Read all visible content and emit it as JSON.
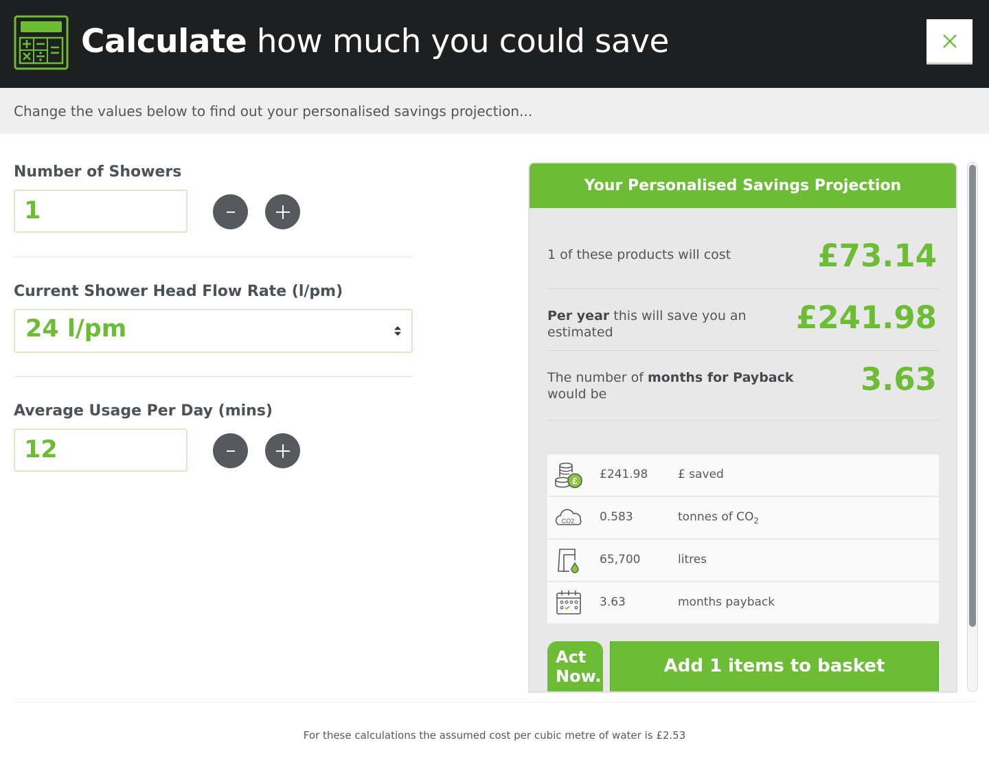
{
  "header": {
    "title_strong": "Calculate",
    "title_rest": "how much you could save",
    "close_icon": "close-icon",
    "icon": "calculator-icon"
  },
  "subheader": {
    "text": "Change the values below to find out your personalised savings projection..."
  },
  "form": {
    "showers": {
      "label": "Number of Showers",
      "value": "1"
    },
    "flow_rate": {
      "label": "Current Shower Head Flow Rate (l/pm)",
      "selected": "24 l/pm"
    },
    "usage": {
      "label": "Average Usage Per Day (mins)",
      "value": "12"
    },
    "minus_symbol": "-",
    "plus_symbol": "+"
  },
  "projection": {
    "title": "Your Personalised Savings Projection",
    "cost": {
      "label": "1 of these products will cost",
      "value": "£73.14"
    },
    "per_year": {
      "label_bold": "Per year",
      "label_rest": " this will save you an estimated",
      "value": "£241.98"
    },
    "payback": {
      "label_a": "The number of ",
      "label_bold": "months for Payback",
      "label_b": " would be",
      "value": "3.63"
    },
    "summary": [
      {
        "icon": "coins-icon",
        "value": "£241.98",
        "label": "£ saved"
      },
      {
        "icon": "co2-cloud-icon",
        "value": "0.583",
        "label": "tonnes of CO",
        "label_sub": "2"
      },
      {
        "icon": "tap-icon",
        "value": "65,700",
        "label": "litres"
      },
      {
        "icon": "calendar-icon",
        "value": "3.63",
        "label": "months payback"
      }
    ],
    "act_now": {
      "line1": "Act",
      "line2": "Now."
    },
    "basket_button": "Add 1 items to basket"
  },
  "footnote": "For these calculations the assumed cost per cubic metre of water is £2.53",
  "colors": {
    "accent": "#6cbd35",
    "header_bg": "#1e1f20",
    "button_dark": "#565a5f"
  }
}
